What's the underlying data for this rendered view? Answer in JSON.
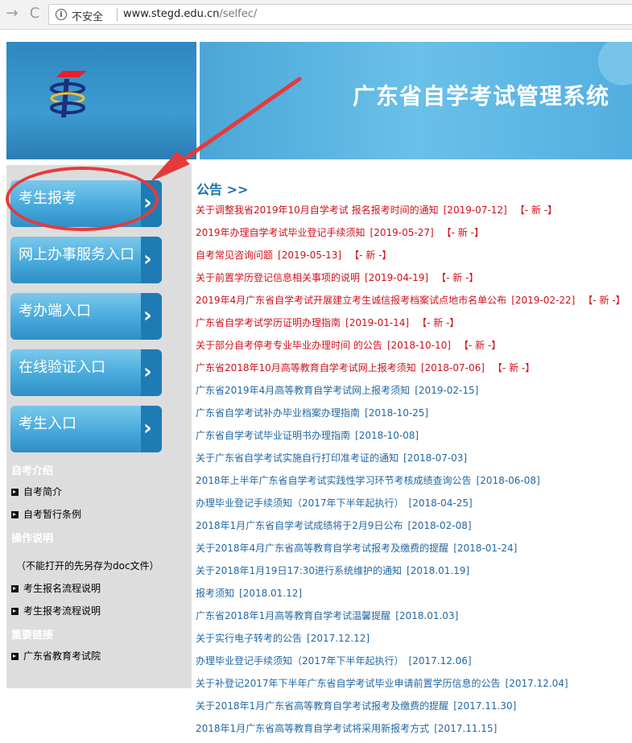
{
  "browser": {
    "security_label": "不安全",
    "url_domain": "www.stegd.edu.cn",
    "url_path": "/selfec/",
    "back_glyph": "→",
    "reload_glyph": "C",
    "info_glyph": "i"
  },
  "banner": {
    "title": "广东省自学考试管理系统"
  },
  "menu": [
    {
      "label": "考生报考"
    },
    {
      "label": "网上办事服务入口"
    },
    {
      "label": "考办端入口"
    },
    {
      "label": "在线验证入口"
    },
    {
      "label": "考生入口"
    }
  ],
  "sidebar": {
    "intro_title": "自考介绍",
    "intro_links": [
      "自考简介",
      "自考暂行条例"
    ],
    "ops_title": "操作说明",
    "ops_note": "（不能打开的先另存为doc文件）",
    "ops_links": [
      "考生报名流程说明",
      "考生报考流程说明"
    ],
    "links_title": "重要链接",
    "important_links": [
      "广东省教育考试院"
    ]
  },
  "notices": {
    "title": "公告 >>",
    "new_tag": "【- 新 -】",
    "items": [
      {
        "text": "关于调整我省2019年10月自学考试 报名报考时间的通知",
        "date": "[2019-07-12]",
        "is_new": true
      },
      {
        "text": "2019年办理自学考试毕业登记手续须知",
        "date": "[2019-05-27]",
        "is_new": true
      },
      {
        "text": "自考常见咨询问题",
        "date": "[2019-05-13]",
        "is_new": true
      },
      {
        "text": "关于前置学历登记信息相关事项的说明",
        "date": "[2019-04-19]",
        "is_new": true
      },
      {
        "text": "2019年4月广东省自学考试开展建立考生诚信报考档案试点地市名单公布",
        "date": "[2019-02-22]",
        "is_new": true
      },
      {
        "text": "广东省自学考试学历证明办理指南",
        "date": "[2019-01-14]",
        "is_new": true
      },
      {
        "text": "关于部分自考停考专业毕业办理时间 的公告",
        "date": "[2018-10-10]",
        "is_new": true
      },
      {
        "text": "广东省2018年10月高等教育自学考试网上报考须知",
        "date": "[2018-07-06]",
        "is_new": true
      },
      {
        "text": "广东省2019年4月高等教育自学考试网上报考须知",
        "date": "[2019-02-15]",
        "is_new": false
      },
      {
        "text": "广东省自学考试补办毕业档案办理指南",
        "date": "[2018-10-25]",
        "is_new": false
      },
      {
        "text": "广东省自学考试毕业证明书办理指南",
        "date": "[2018-10-08]",
        "is_new": false
      },
      {
        "text": "关于广东省自学考试实施自行打印准考证的通知",
        "date": "[2018-07-03]",
        "is_new": false
      },
      {
        "text": "2018年上半年广东省自学考试实践性学习环节考核成绩查询公告",
        "date": "[2018-06-08]",
        "is_new": false
      },
      {
        "text": "办理毕业登记手续须知（2017年下半年起执行）",
        "date": "[2018-04-25]",
        "is_new": false
      },
      {
        "text": "2018年1月广东省自学考试成绩将于2月9日公布",
        "date": "[2018-02-08]",
        "is_new": false
      },
      {
        "text": "关于2018年4月广东省高等教育自学考试报考及缴费的提醒",
        "date": "[2018-01-24]",
        "is_new": false
      },
      {
        "text": "关于2018年1月19日17:30进行系统维护的通知",
        "date": "[2018.01.19]",
        "is_new": false
      },
      {
        "text": "报考须知",
        "date": "[2018.01.12]",
        "is_new": false
      },
      {
        "text": "广东省2018年1月高等教育自学考试温馨提醒",
        "date": "[2018.01.03]",
        "is_new": false
      },
      {
        "text": "关于实行电子转考的公告",
        "date": "[2017.12.12]",
        "is_new": false
      },
      {
        "text": "办理毕业登记手续须知（2017年下半年起执行）",
        "date": "[2017.12.06]",
        "is_new": false
      },
      {
        "text": "关于补登记2017年下半年广东省自学考试毕业申请前置学历信息的公告",
        "date": "[2017.12.04]",
        "is_new": false
      },
      {
        "text": "关于2018年1月广东省高等教育自学考试报考及缴费的提醒",
        "date": "[2017.11.30]",
        "is_new": false
      },
      {
        "text": "2018年1月广东省高等教育自学考试将采用新报考方式",
        "date": "[2017.11.15]",
        "is_new": false
      }
    ]
  },
  "colors": {
    "accent_blue": "#2f8fc6",
    "annotation_red": "#e63a3a",
    "new_red": "#d0111b"
  }
}
